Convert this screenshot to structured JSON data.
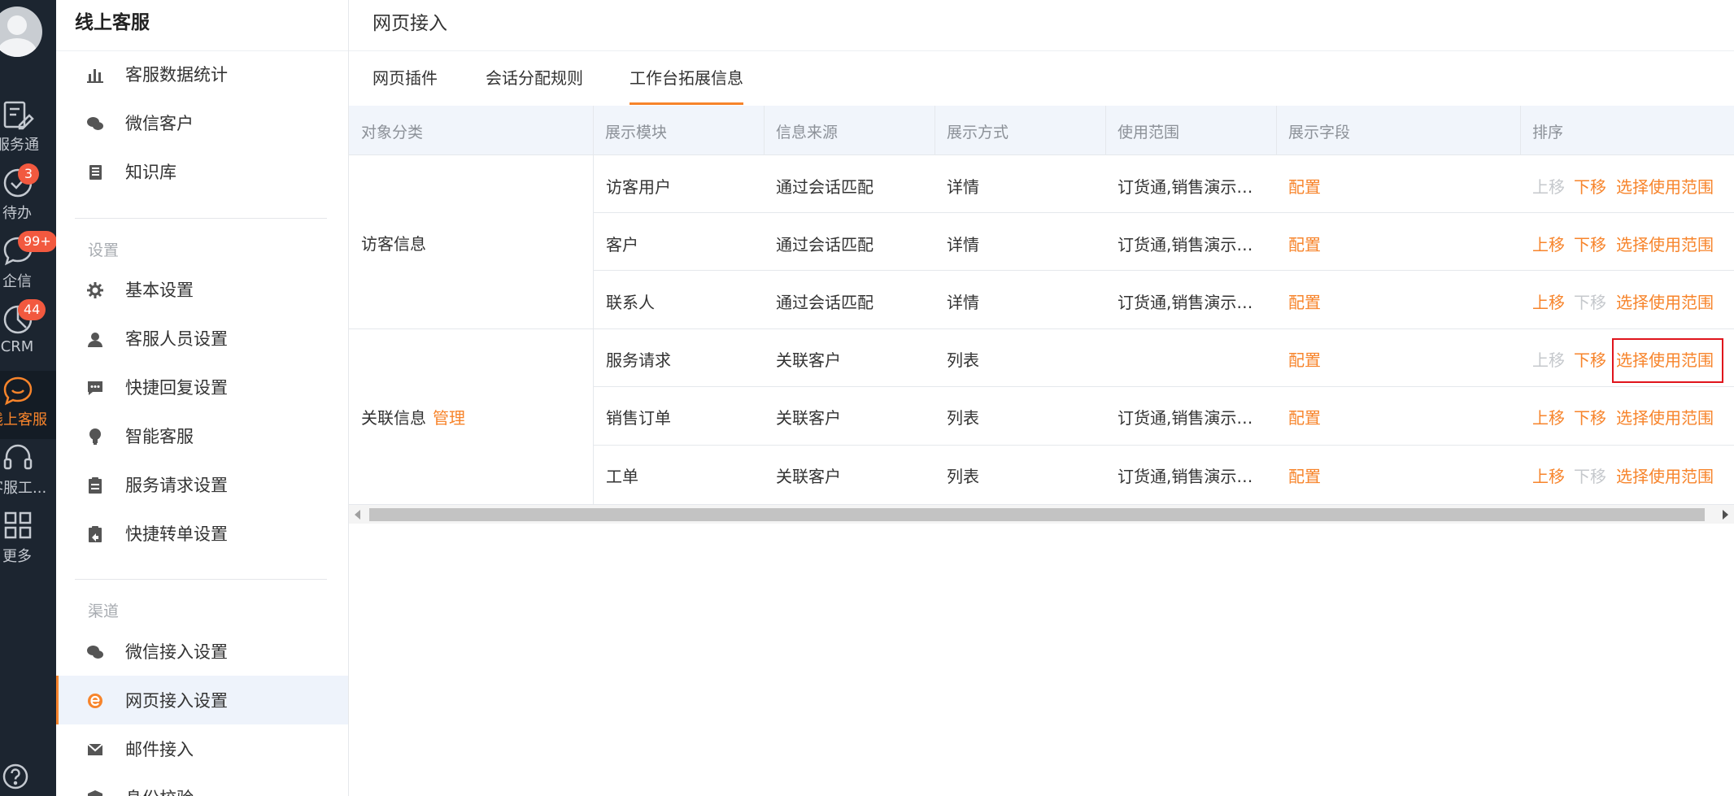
{
  "rail": {
    "items": [
      {
        "label": "服务通",
        "icon": "service-tool-icon"
      },
      {
        "label": "待办",
        "icon": "check-circle-icon",
        "badge": "3"
      },
      {
        "label": "企信",
        "icon": "chat-bubble-icon",
        "badge": "99+"
      },
      {
        "label": "CRM",
        "icon": "crm-icon",
        "badge": "44"
      },
      {
        "label": "线上客服",
        "icon": "smile-chat-icon",
        "active": true
      },
      {
        "label": "客服工...",
        "icon": "headset-icon"
      },
      {
        "label": "更多",
        "icon": "grid-icon"
      }
    ]
  },
  "sidebar": {
    "title": "线上客服",
    "groups": [
      {
        "items": [
          {
            "label": "客服数据统计",
            "icon": "bar-chart-icon"
          },
          {
            "label": "微信客户",
            "icon": "wechat-icon"
          },
          {
            "label": "知识库",
            "icon": "book-icon"
          }
        ]
      },
      {
        "title": "设置",
        "items": [
          {
            "label": "基本设置",
            "icon": "gear-icon"
          },
          {
            "label": "客服人员设置",
            "icon": "agent-icon"
          },
          {
            "label": "快捷回复设置",
            "icon": "message-dots-icon"
          },
          {
            "label": "智能客服",
            "icon": "lightbulb-icon"
          },
          {
            "label": "服务请求设置",
            "icon": "clipboard-icon"
          },
          {
            "label": "快捷转单设置",
            "icon": "transfer-doc-icon"
          }
        ]
      },
      {
        "title": "渠道",
        "items": [
          {
            "label": "微信接入设置",
            "icon": "wechat-icon"
          },
          {
            "label": "网页接入设置",
            "icon": "ie-browser-icon",
            "selected": true
          },
          {
            "label": "邮件接入",
            "icon": "mail-icon"
          },
          {
            "label": "身份校验",
            "icon": "shield-icon"
          }
        ]
      }
    ]
  },
  "main": {
    "title": "网页接入",
    "tabs": [
      {
        "label": "网页插件"
      },
      {
        "label": "会话分配规则"
      },
      {
        "label": "工作台拓展信息",
        "active": true
      }
    ],
    "table": {
      "headers": [
        "对象分类",
        "展示模块",
        "信息来源",
        "展示方式",
        "使用范围",
        "展示字段",
        "排序"
      ],
      "groups": [
        {
          "label": "访客信息",
          "action": ""
        },
        {
          "label": "关联信息",
          "action": "管理"
        }
      ],
      "rows": [
        {
          "module": "访客用户",
          "source": "通过会话匹配",
          "display": "详情",
          "scope": "订货通,销售演示…",
          "field": "配置",
          "up": "上移",
          "up_enabled": false,
          "down": "下移",
          "down_enabled": true,
          "range": "选择使用范围"
        },
        {
          "module": "客户",
          "source": "通过会话匹配",
          "display": "详情",
          "scope": "订货通,销售演示…",
          "field": "配置",
          "up": "上移",
          "up_enabled": true,
          "down": "下移",
          "down_enabled": true,
          "range": "选择使用范围"
        },
        {
          "module": "联系人",
          "source": "通过会话匹配",
          "display": "详情",
          "scope": "订货通,销售演示…",
          "field": "配置",
          "up": "上移",
          "up_enabled": true,
          "down": "下移",
          "down_enabled": false,
          "range": "选择使用范围"
        },
        {
          "module": "服务请求",
          "source": "关联客户",
          "display": "列表",
          "scope": "",
          "field": "配置",
          "up": "上移",
          "up_enabled": false,
          "down": "下移",
          "down_enabled": true,
          "range": "选择使用范围",
          "highlighted": true
        },
        {
          "module": "销售订单",
          "source": "关联客户",
          "display": "列表",
          "scope": "订货通,销售演示…",
          "field": "配置",
          "up": "上移",
          "up_enabled": true,
          "down": "下移",
          "down_enabled": true,
          "range": "选择使用范围"
        },
        {
          "module": "工单",
          "source": "关联客户",
          "display": "列表",
          "scope": "订货通,销售演示…",
          "field": "配置",
          "up": "上移",
          "up_enabled": true,
          "down": "下移",
          "down_enabled": false,
          "range": "选择使用范围"
        }
      ]
    }
  },
  "colors": {
    "accent": "#f7842b",
    "rail_bg": "#1c2530",
    "badge": "#f2593f",
    "highlight": "#e0141c",
    "disabled": "#c5c8cc"
  }
}
